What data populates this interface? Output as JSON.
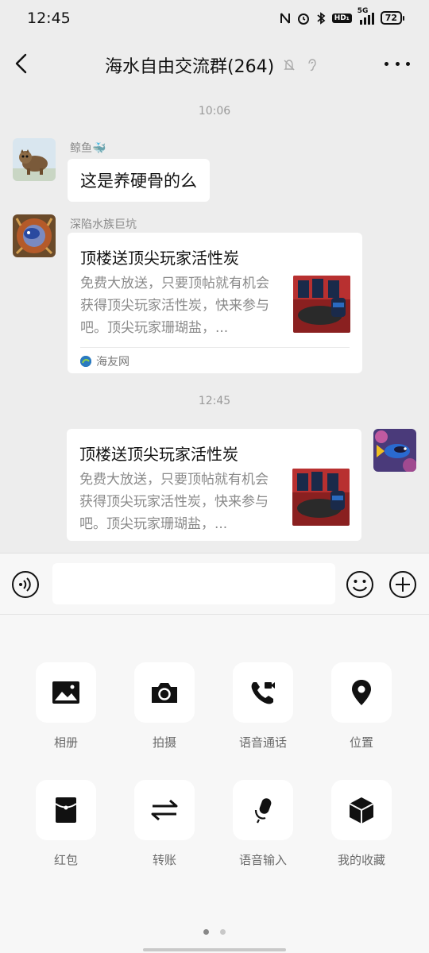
{
  "status_bar": {
    "time": "12:45",
    "hd_label": "HD₁",
    "network": "5G",
    "battery": "72"
  },
  "header": {
    "title": "海水自由交流群(264)"
  },
  "messages": {
    "ts1": "10:06",
    "m1": {
      "sender": "鲸鱼🐳",
      "text": "这是养硬骨的么"
    },
    "m2": {
      "sender": "深陷水族巨坑",
      "title": "顶楼送顶尖玩家活性炭",
      "desc": "免费大放送，只要顶帖就有机会获得顶尖玩家活性炭，快来参与吧。顶尖玩家珊瑚盐，...",
      "source": "海友网"
    },
    "ts2": "12:45",
    "m3": {
      "title": "顶楼送顶尖玩家活性炭",
      "desc": "免费大放送，只要顶帖就有机会获得顶尖玩家活性炭，快来参与吧。顶尖玩家珊瑚盐，..."
    }
  },
  "input": {
    "placeholder": ""
  },
  "tools": {
    "album": "相册",
    "camera": "拍摄",
    "voice_call": "语音通话",
    "location": "位置",
    "red_packet": "红包",
    "transfer": "转账",
    "voice_input": "语音输入",
    "favorites": "我的收藏"
  }
}
